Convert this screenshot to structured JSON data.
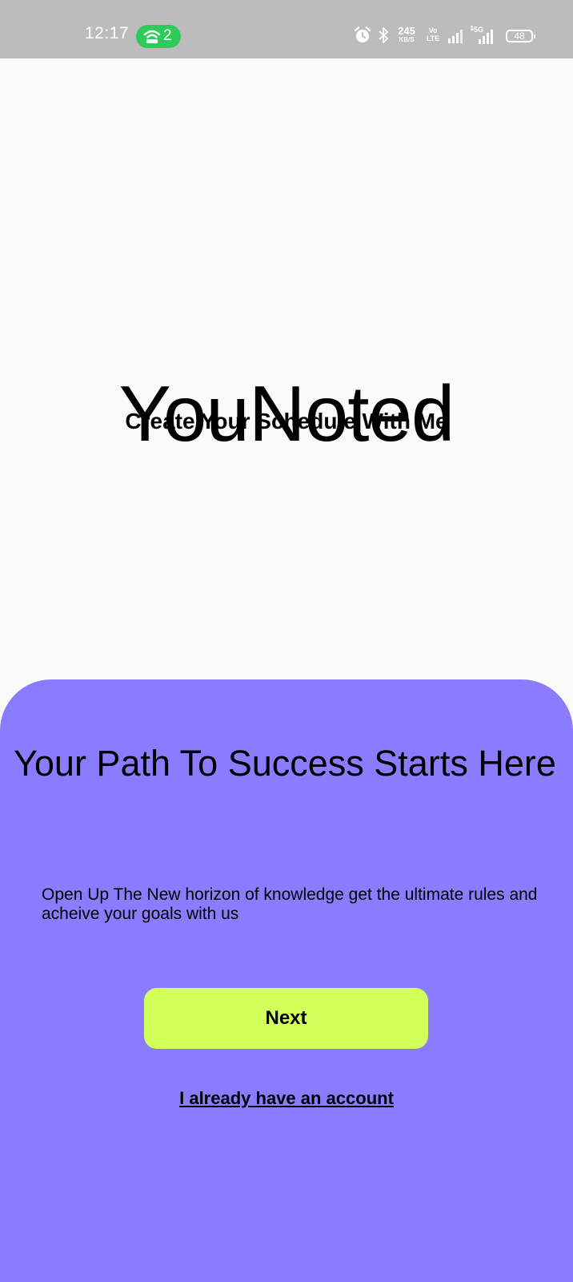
{
  "status_bar": {
    "time": "12:17",
    "hotspot_count": "2",
    "network_speed_value": "245",
    "network_speed_unit": "KB/S",
    "volte_top": "Vo",
    "volte_bottom": "LTE",
    "network_type": "5G",
    "battery_level": "48",
    "icons": [
      "hotspot-icon",
      "alarm-icon",
      "bluetooth-icon",
      "signal-icon",
      "signal-5g-icon",
      "battery-icon"
    ]
  },
  "hero": {
    "app_name": "YouNoted",
    "tagline": "Create Your Schedule With Me"
  },
  "sheet": {
    "headline": "Your Path To Success Starts Here",
    "description": "Open Up The New horizon of knowledge get the ultimate rules and acheive your goals with us",
    "next_label": "Next",
    "signin_label": "I already have an account"
  },
  "colors": {
    "status_bar": "#bcbcbc",
    "hotspot_pill": "#2fcb5a",
    "page_background": "#fafafa",
    "sheet_background": "#8b7cff",
    "next_button": "#d3ff5a",
    "text": "#000000"
  }
}
